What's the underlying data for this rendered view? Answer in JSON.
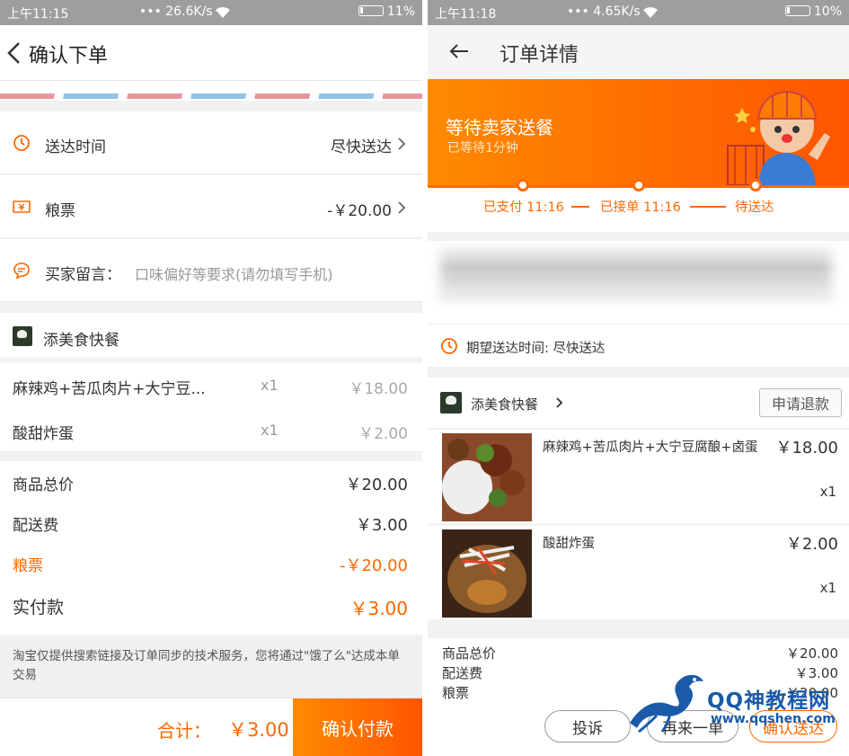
{
  "left": {
    "status": {
      "time": "上午11:15",
      "speed": "26.6K/s",
      "battery": "11%"
    },
    "header": {
      "title": "确认下单"
    },
    "delivery": {
      "label": "送达时间",
      "value": "尽快送达"
    },
    "voucher": {
      "label": "粮票",
      "value": "-￥20.00"
    },
    "message": {
      "label": "买家留言：",
      "placeholder": "口味偏好等要求(请勿填写手机)"
    },
    "shop": {
      "name": "添美食快餐"
    },
    "items": [
      {
        "name": "麻辣鸡+苦瓜肉片+大宁豆...",
        "qty": "x1",
        "price": "￥18.00"
      },
      {
        "name": "酸甜炸蛋",
        "qty": "x1",
        "price": "￥2.00"
      }
    ],
    "summary": {
      "goods_label": "商品总价",
      "goods_value": "￥20.00",
      "delivery_label": "配送费",
      "delivery_value": "￥3.00",
      "voucher_label": "粮票",
      "voucher_value": "-￥20.00",
      "paid_label": "实付款",
      "paid_value": "￥3.00"
    },
    "notice": "淘宝仅提供搜索链接及订单同步的技术服务，您将通过\"饿了么\"达成本单交易",
    "paybar": {
      "total_label": "合计：",
      "total_value": "￥3.00",
      "pay_button": "确认付款"
    }
  },
  "right": {
    "status": {
      "time": "上午11:18",
      "speed": "4.65K/s",
      "battery": "10%"
    },
    "header": {
      "title": "订单详情"
    },
    "banner": {
      "status": "等待卖家送餐",
      "waited": "已等待1分钟"
    },
    "progress": {
      "step1": "已支付 11:16",
      "step2": "已接单 11:16",
      "step3": "待送达"
    },
    "eta": "期望送达时间: 尽快送达",
    "shop": {
      "name": "添美食快餐",
      "refund_button": "申请退款"
    },
    "items": [
      {
        "name": "麻辣鸡+苦瓜肉片+大宁豆腐酿+卤蛋",
        "price": "￥18.00",
        "qty": "x1"
      },
      {
        "name": "酸甜炸蛋",
        "price": "￥2.00",
        "qty": "x1"
      }
    ],
    "summary": {
      "goods_label": "商品总价",
      "goods_value": "￥20.00",
      "delivery_label": "配送费",
      "delivery_value": "￥3.00",
      "voucher_label": "粮票",
      "voucher_value": "-￥20.00"
    },
    "actions": {
      "complain": "投诉",
      "reorder": "再来一单",
      "confirm": "确认送达"
    }
  },
  "watermark": {
    "line1": "QQ神教程网",
    "line2": "www.qqshen.com"
  },
  "colors": {
    "accent": "#ff6600",
    "banner": "#ff7a00",
    "airmail_red": "#e8969a",
    "airmail_blue": "#8fc3ea"
  }
}
